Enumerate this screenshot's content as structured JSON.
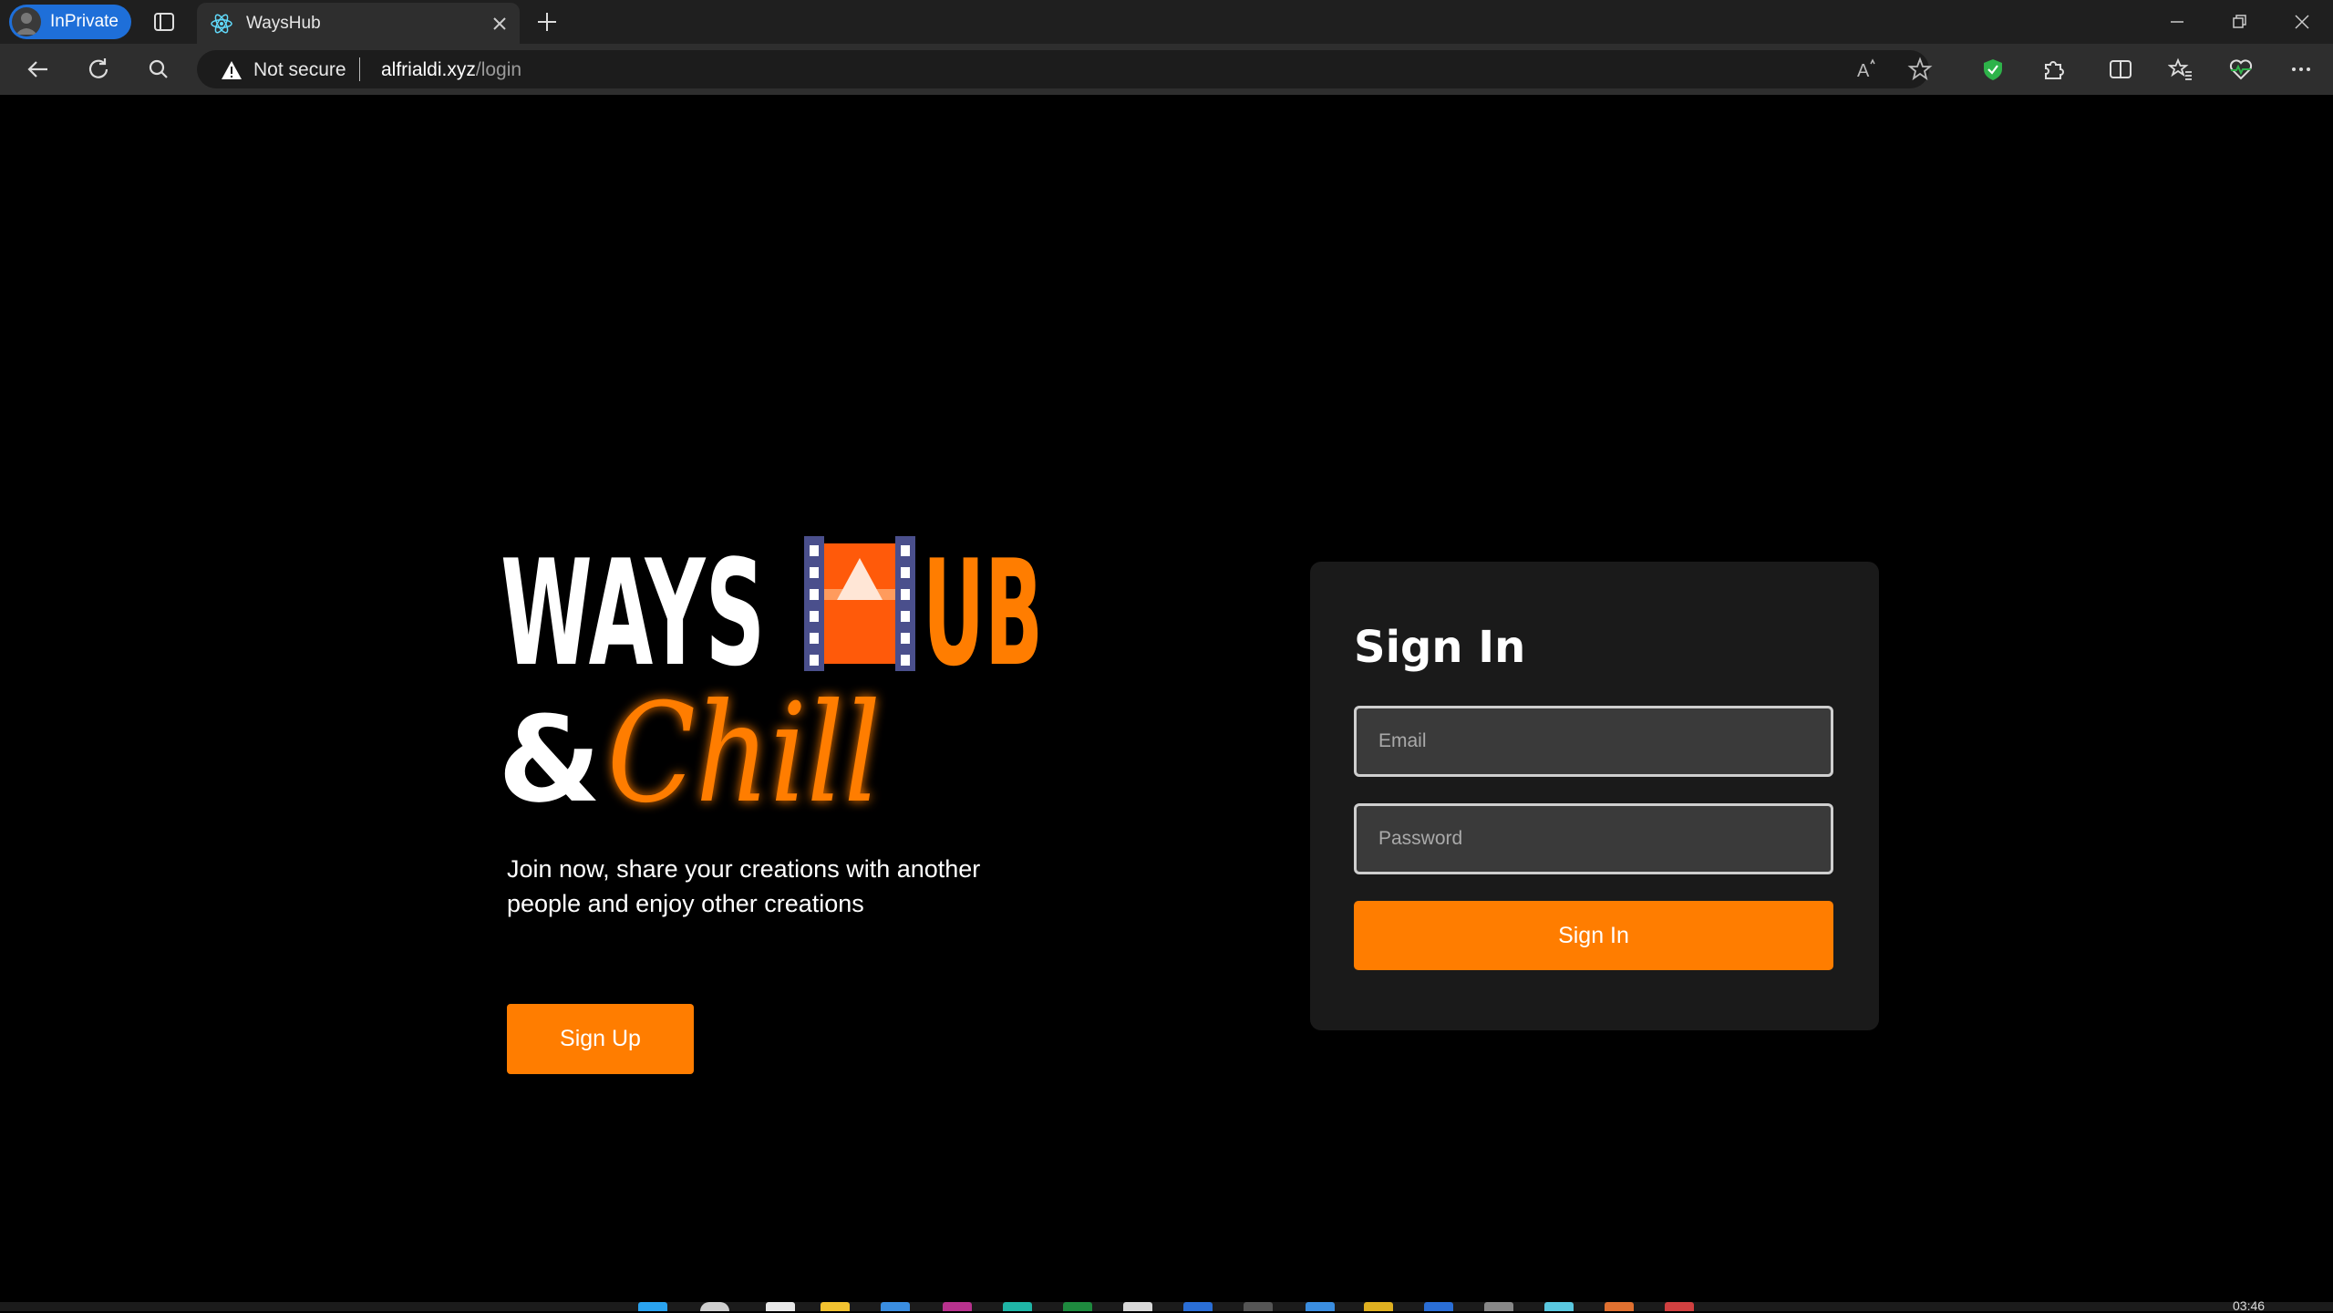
{
  "browser": {
    "inprivate_label": "InPrivate",
    "tab_title": "WaysHub",
    "security_label": "Not secure",
    "url_host": "alfrialdi.xyz",
    "url_path": "/login",
    "read_aloud_text": "A"
  },
  "logo": {
    "word_ways": "WAYS",
    "word_ub": "UB",
    "ampersand": "&",
    "script_word": "Chill"
  },
  "hero": {
    "tagline_line1": "Join now, share your creations with another",
    "tagline_line2": "people and enjoy other creations",
    "signup_label": "Sign Up"
  },
  "signin": {
    "heading": "Sign In",
    "email_placeholder": "Email",
    "password_placeholder": "Password",
    "submit_label": "Sign In"
  },
  "taskbar": {
    "clock": "03:46"
  },
  "colors": {
    "accent": "#ff7d00",
    "film_strip": "#4a4f8c",
    "card_bg": "#1a1a1a",
    "inprivate": "#1e6fd9"
  }
}
